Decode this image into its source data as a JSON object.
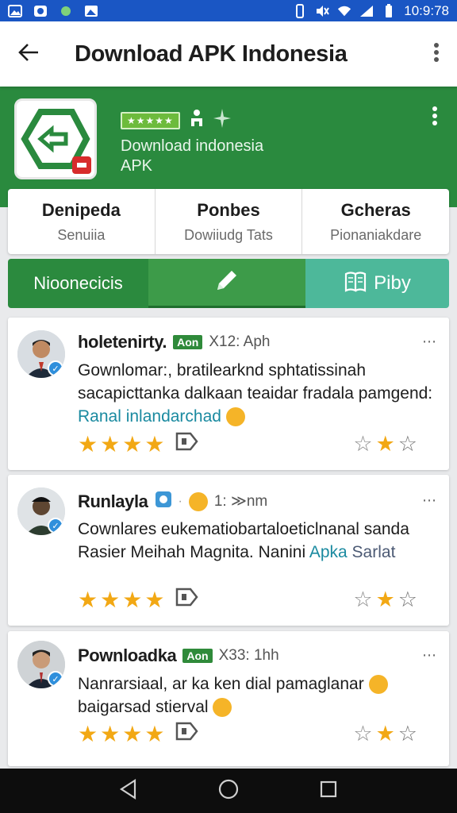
{
  "status": {
    "time": "10:9:78"
  },
  "appbar": {
    "title": "Download APK Indonesia"
  },
  "hero": {
    "rating_badge": "★★★★★",
    "name_line1": "Download indonesia",
    "name_line2": "APK"
  },
  "stats": [
    {
      "value": "Denipeda",
      "label": "Senuiia"
    },
    {
      "value": "Ponbes",
      "label": "Dowiiudg Tats"
    },
    {
      "value": "Gcheras",
      "label": "Pionaniakdare"
    }
  ],
  "actions": {
    "left_label": "Nioonecicis",
    "right_label": "Piby"
  },
  "reviews": [
    {
      "name": "holetenirty.",
      "tag": "Aon",
      "meta": "X12: Aph",
      "text": "Gownlomar:, bratilearknd sphtatissinah sacapicttanka dalkaan teaidar fradala pamgend:",
      "highlight": "Ranal inlandarchad"
    },
    {
      "name": "Runlayla",
      "tag": "",
      "meta": "1: ≫nm",
      "text": "Cownlares eukematiobartaloeticlnanal sanda Rasier Meihah Magnita. Nanini",
      "highlight": "Apka",
      "text2": "Sarlat"
    },
    {
      "name": "Pownloadka",
      "tag": "Aon",
      "meta": "X33: 1hh",
      "text": "Nanrarsiaal, ar ka ken dial pamaglanar",
      "text2": "baigarsad stierval"
    }
  ],
  "colors": {
    "status_bar": "#1a56c4",
    "hero": "#2a8a3e",
    "accent_teal": "#4db89a",
    "star": "#f2a814"
  }
}
